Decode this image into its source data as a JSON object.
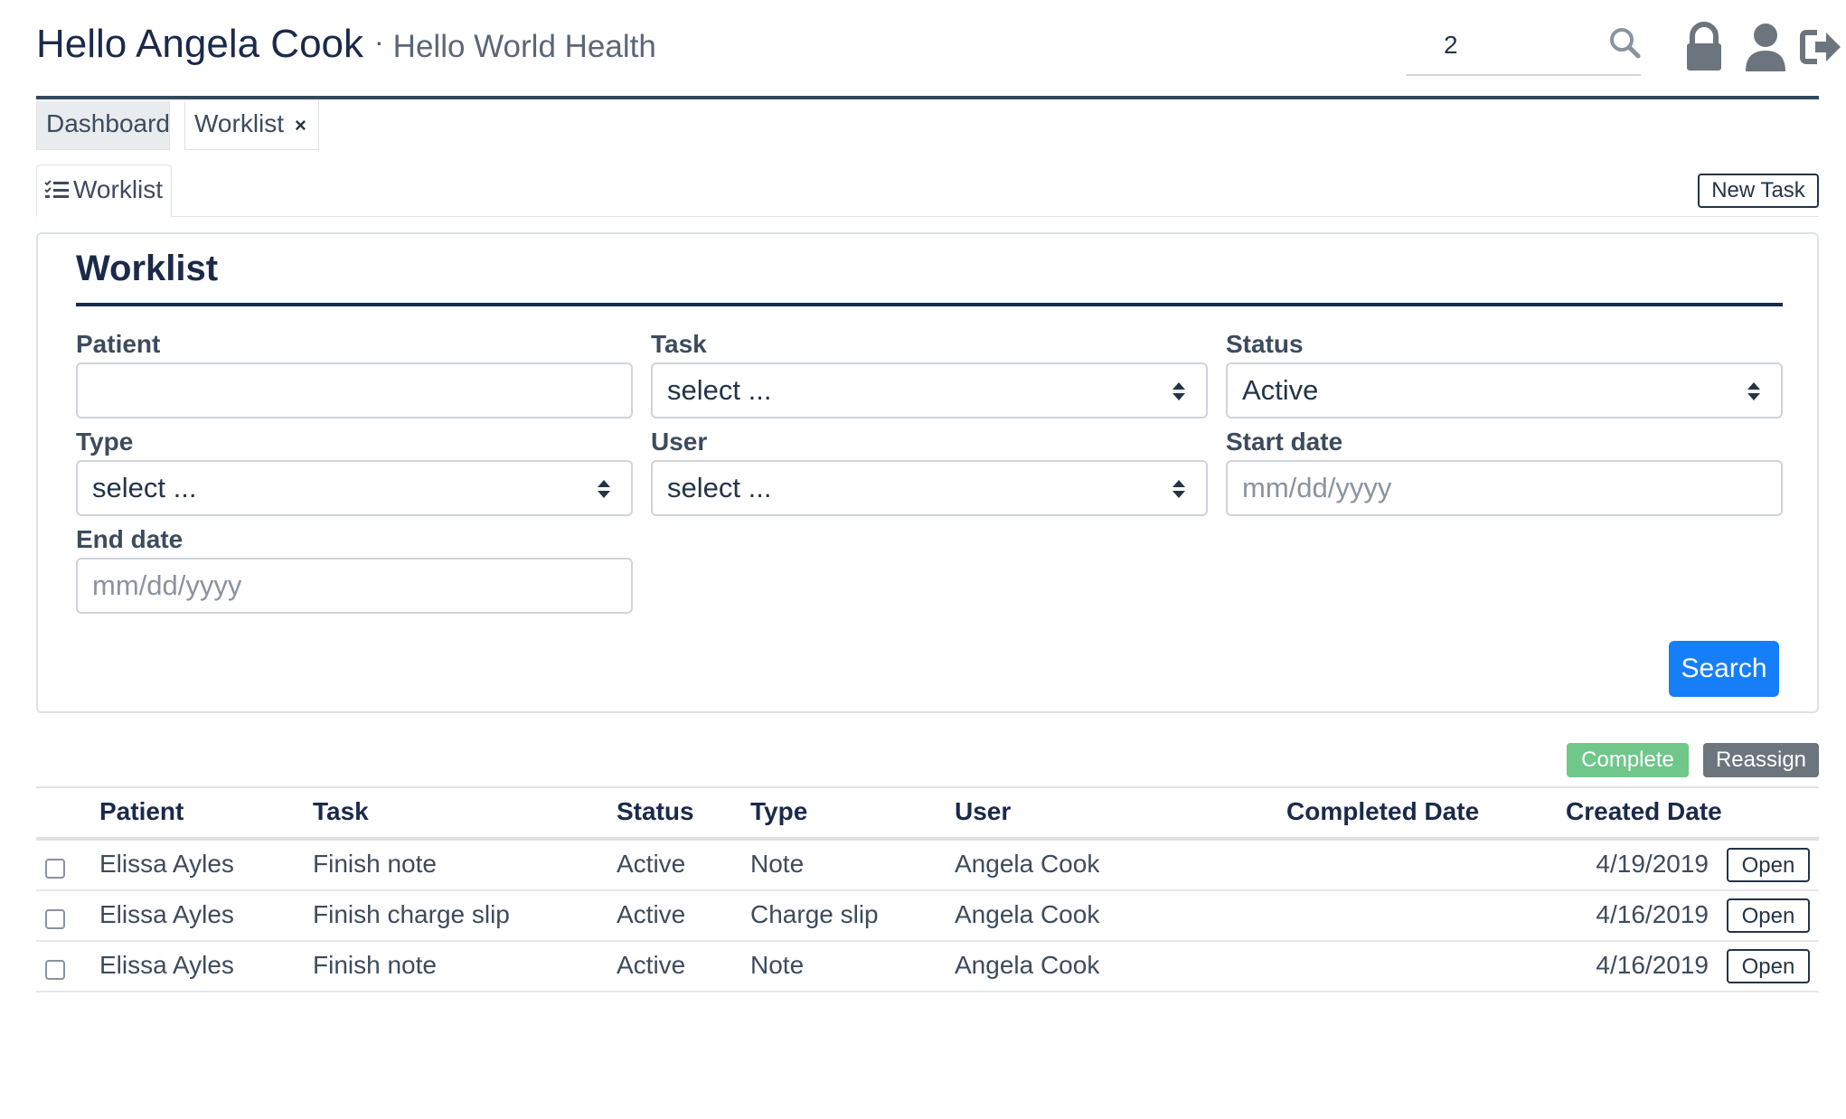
{
  "header": {
    "greeting": "Hello Angela Cook",
    "separator": "·",
    "organization": "Hello World Health",
    "search_value": "2"
  },
  "icons": {
    "search": "search-icon",
    "lock": "lock-icon",
    "user": "user-icon",
    "logout": "logout-icon"
  },
  "tabs": [
    {
      "label": "Dashboard",
      "active": true
    },
    {
      "label": "Worklist",
      "closable": true,
      "close_glyph": "×"
    }
  ],
  "subtab": {
    "label": "Worklist"
  },
  "toolbar": {
    "new_task_label": "New Task"
  },
  "filters": {
    "title": "Worklist",
    "patient": {
      "label": "Patient",
      "value": ""
    },
    "task": {
      "label": "Task",
      "value": "select ..."
    },
    "status": {
      "label": "Status",
      "value": "Active"
    },
    "type": {
      "label": "Type",
      "value": "select ..."
    },
    "user": {
      "label": "User",
      "value": "select ..."
    },
    "start_date": {
      "label": "Start date",
      "placeholder": "mm/dd/yyyy"
    },
    "end_date": {
      "label": "End date",
      "placeholder": "mm/dd/yyyy"
    },
    "search_label": "Search"
  },
  "actions": {
    "complete_label": "Complete",
    "reassign_label": "Reassign"
  },
  "table": {
    "columns": [
      "Patient",
      "Task",
      "Status",
      "Type",
      "User",
      "Completed Date",
      "Created Date"
    ],
    "rows": [
      {
        "patient": "Elissa Ayles",
        "task": "Finish note",
        "status": "Active",
        "type": "Note",
        "user": "Angela Cook",
        "completed": "",
        "created": "4/19/2019",
        "action": "Open"
      },
      {
        "patient": "Elissa Ayles",
        "task": "Finish charge slip",
        "status": "Active",
        "type": "Charge slip",
        "user": "Angela Cook",
        "completed": "",
        "created": "4/16/2019",
        "action": "Open"
      },
      {
        "patient": "Elissa Ayles",
        "task": "Finish note",
        "status": "Active",
        "type": "Note",
        "user": "Angela Cook",
        "completed": "",
        "created": "4/16/2019",
        "action": "Open"
      }
    ]
  },
  "colors": {
    "primary": "#157ef8",
    "success": "#6fc78a",
    "secondary": "#6c757d",
    "heading": "#1b2a4a"
  }
}
